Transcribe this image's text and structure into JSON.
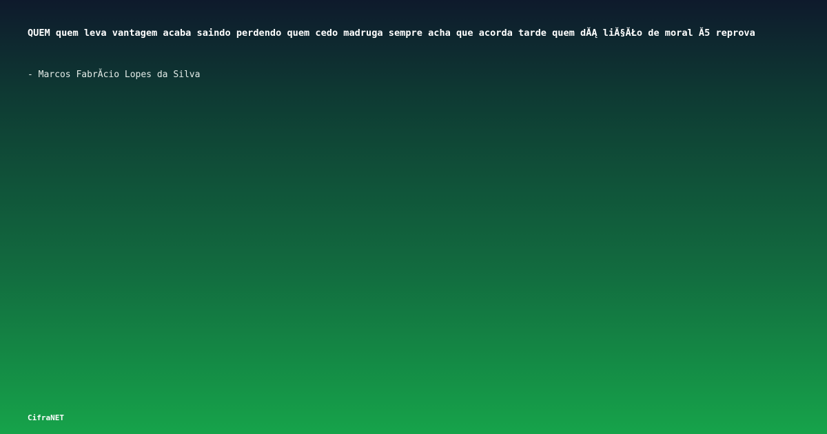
{
  "quote": {
    "text": "QUEM quem leva vantagem acaba saindo perdendo quem cedo madruga sempre acha que acorda tarde quem dĂĄ liĂ§ĂŁo de moral Ă5 reprova"
  },
  "author": {
    "text": "- Marcos FabrĂ­cio Lopes da Silva"
  },
  "brand": {
    "name": "CifraNET"
  },
  "colors": {
    "gradient_top": "#0e1a2c",
    "gradient_mid": "#126b3f",
    "gradient_bottom": "#16a34a",
    "text": "#ffffff"
  }
}
